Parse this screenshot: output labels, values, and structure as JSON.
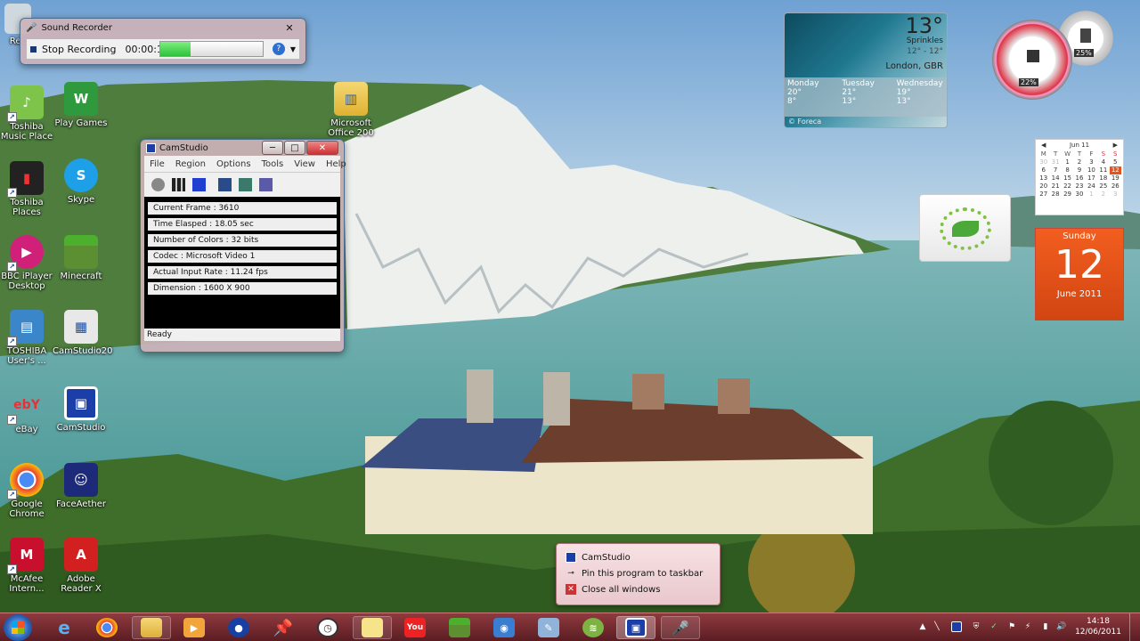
{
  "desktop": {
    "icons": [
      {
        "label": "Rec",
        "icon": "recycle-bin-icon"
      },
      {
        "label": "Toshiba Music Place",
        "icon": "music-place-icon"
      },
      {
        "label": "Play Games",
        "icon": "games-icon"
      },
      {
        "label": "Toshiba Places",
        "icon": "toshiba-places-icon"
      },
      {
        "label": "Skype",
        "icon": "skype-icon"
      },
      {
        "label": "BBC iPlayer Desktop",
        "icon": "bbc-iplayer-icon"
      },
      {
        "label": "Minecraft",
        "icon": "minecraft-icon"
      },
      {
        "label": "TOSHIBA User's ...",
        "icon": "toshiba-manual-icon"
      },
      {
        "label": "CamStudio20",
        "icon": "camstudio-folder-icon"
      },
      {
        "label": "eBay",
        "icon": "ebay-icon"
      },
      {
        "label": "CamStudio",
        "icon": "camstudio-icon"
      },
      {
        "label": "Google Chrome",
        "icon": "chrome-icon"
      },
      {
        "label": "FaceAether",
        "icon": "faceaether-icon"
      },
      {
        "label": "McAfee Intern...",
        "icon": "mcafee-icon"
      },
      {
        "label": "Adobe Reader X",
        "icon": "adobe-reader-icon"
      },
      {
        "label": "Microsoft Office 200",
        "icon": "office-folder-icon"
      }
    ]
  },
  "sound_recorder": {
    "title": "Sound Recorder",
    "stop_label": "Stop Recording",
    "time": "00:00:18",
    "level_fraction": 0.3
  },
  "camstudio": {
    "title": "CamStudio",
    "menu": [
      "File",
      "Region",
      "Options",
      "Tools",
      "View",
      "Help"
    ],
    "stats": [
      "Current Frame : 3610",
      "Time Elasped : 18.05 sec",
      "Number of Colors : 32 bits",
      "Codec : Microsoft Video 1",
      "Actual Input Rate : 11.24 fps",
      "Dimension : 1600 X 900"
    ],
    "status": "Ready"
  },
  "weather": {
    "temp": "13°",
    "condition": "Sprinkles",
    "range": "12° - 12°",
    "location": "London, GBR",
    "days": [
      {
        "name": "Monday",
        "high": "20°",
        "low": "8°"
      },
      {
        "name": "Tuesday",
        "high": "21°",
        "low": "13°"
      },
      {
        "name": "Wednesday",
        "high": "19°",
        "low": "13°"
      }
    ],
    "provider": "© Foreca"
  },
  "meter": {
    "cpu": "22%",
    "memory": "25%"
  },
  "calendar": {
    "month": "Jun 11",
    "weekdays": [
      "M",
      "T",
      "W",
      "T",
      "F",
      "S",
      "S"
    ],
    "weeks": [
      [
        "30",
        "31",
        "1",
        "2",
        "3",
        "4",
        "5"
      ],
      [
        "6",
        "7",
        "8",
        "9",
        "10",
        "11",
        "12"
      ],
      [
        "13",
        "14",
        "15",
        "16",
        "17",
        "18",
        "19"
      ],
      [
        "20",
        "21",
        "22",
        "23",
        "24",
        "25",
        "26"
      ],
      [
        "27",
        "28",
        "29",
        "30",
        "1",
        "2",
        "3"
      ]
    ],
    "day_name": "Sunday",
    "day_number": "12",
    "month_year": "June 2011"
  },
  "jump_list": {
    "items": [
      {
        "label": "CamStudio",
        "icon": "camstudio-icon"
      },
      {
        "label": "Pin this program to taskbar",
        "icon": "pin-icon"
      },
      {
        "label": "Close all windows",
        "icon": "close-icon"
      }
    ]
  },
  "taskbar": {
    "clock_time": "14:18",
    "clock_date": "12/06/2011",
    "apps": [
      "internet-explorer-icon",
      "chrome-icon",
      "explorer-icon",
      "media-player-icon",
      "messenger-icon",
      "pin-icon",
      "clock-icon",
      "sticky-notes-icon",
      "youtube-icon",
      "minecraft-icon",
      "camera-icon",
      "paint-icon",
      "spotify-icon",
      "camstudio-icon",
      "sound-recorder-icon"
    ],
    "youtube_label": "You"
  },
  "colors": {
    "taskbar": "#6b2329",
    "accent_green": "#3bc44a",
    "calendar_orange": "#e4531b"
  }
}
